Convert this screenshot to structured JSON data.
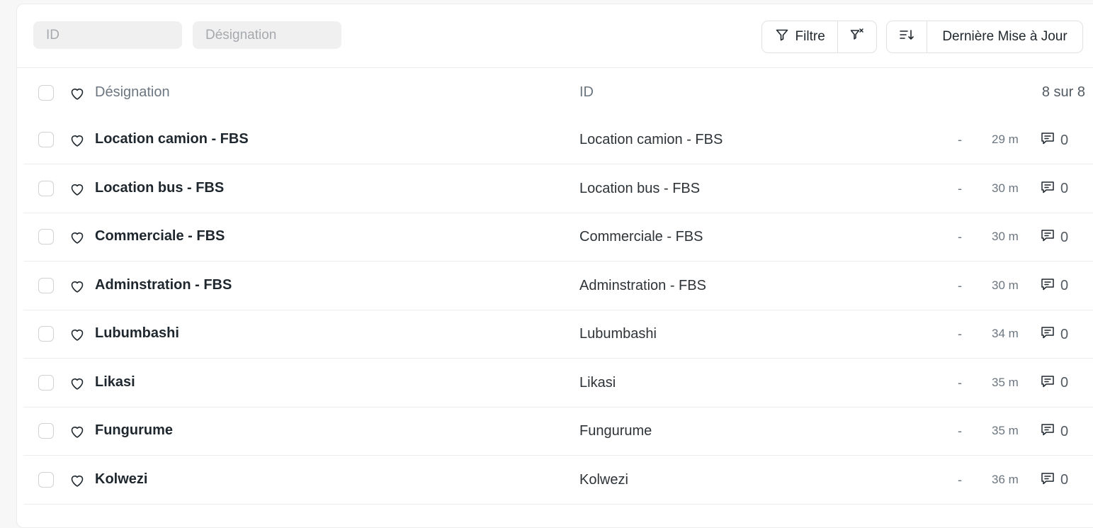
{
  "filters": {
    "id_placeholder": "ID",
    "designation_placeholder": "Désignation"
  },
  "toolbar": {
    "filter_label": "Filtre",
    "sort_field_label": "Dernière Mise à Jour"
  },
  "list_header": {
    "designation": "Désignation",
    "id": "ID",
    "count": "8 sur 8"
  },
  "rows": [
    {
      "title": "Location camion - FBS",
      "id": "Location camion - FBS",
      "status": "-",
      "modified": "29 m",
      "comments": "0"
    },
    {
      "title": "Location bus - FBS",
      "id": "Location bus - FBS",
      "status": "-",
      "modified": "30 m",
      "comments": "0"
    },
    {
      "title": "Commerciale - FBS",
      "id": "Commerciale - FBS",
      "status": "-",
      "modified": "30 m",
      "comments": "0"
    },
    {
      "title": "Adminstration - FBS",
      "id": "Adminstration - FBS",
      "status": "-",
      "modified": "30 m",
      "comments": "0"
    },
    {
      "title": "Lubumbashi",
      "id": "Lubumbashi",
      "status": "-",
      "modified": "34 m",
      "comments": "0"
    },
    {
      "title": "Likasi",
      "id": "Likasi",
      "status": "-",
      "modified": "35 m",
      "comments": "0"
    },
    {
      "title": "Fungurume",
      "id": "Fungurume",
      "status": "-",
      "modified": "35 m",
      "comments": "0"
    },
    {
      "title": "Kolwezi",
      "id": "Kolwezi",
      "status": "-",
      "modified": "36 m",
      "comments": "0"
    }
  ],
  "icons": {
    "filter": "filter-icon",
    "clear_filter": "filter-x-icon",
    "sort_direction": "sort-descending-icon",
    "like": "heart-icon",
    "comment": "comment-icon"
  }
}
